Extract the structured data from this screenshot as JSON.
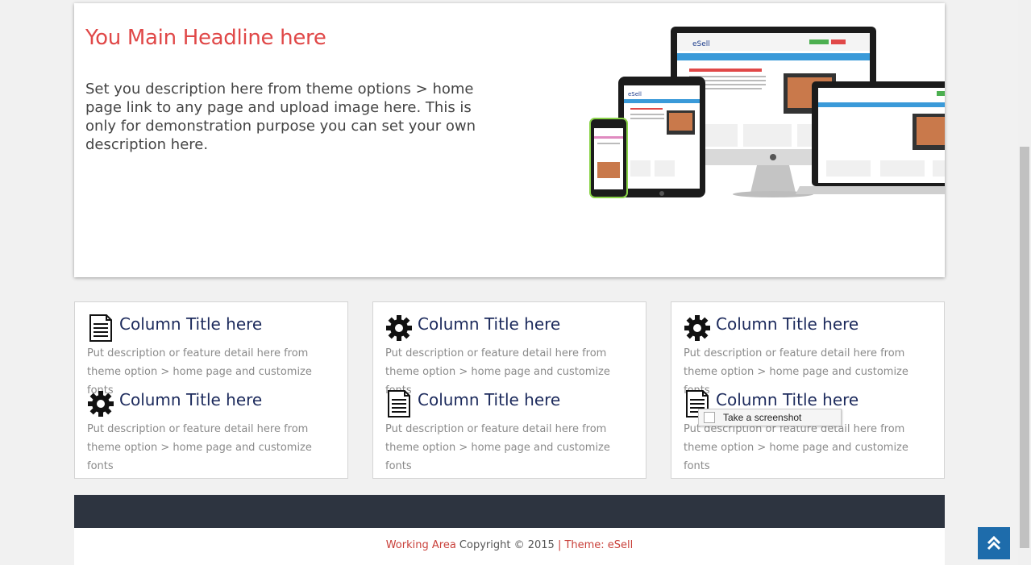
{
  "hero": {
    "headline": "You Main Headline here",
    "description": "Set you description here from theme options > home page link to any page and upload image here. This is only for demonstration purpose you can set your own description here."
  },
  "features": [
    [
      {
        "icon": "document-icon",
        "title": "Column Title here",
        "desc": "Put description or feature detail here from theme option > home page and customize fonts"
      },
      {
        "icon": "gear-icon",
        "title": "Column Title here",
        "desc": "Put description or feature detail here from theme option > home page and customize fonts"
      }
    ],
    [
      {
        "icon": "gear-icon",
        "title": "Column Title here",
        "desc": "Put description or feature detail here from theme option > home page and customize fonts"
      },
      {
        "icon": "document-icon",
        "title": "Column Title here",
        "desc": "Put description or feature detail here from theme option > home page and customize fonts"
      }
    ],
    [
      {
        "icon": "gear-icon",
        "title": "Column Title here",
        "desc": "Put description or feature detail here from theme option > home page and customize fonts"
      },
      {
        "icon": "document-icon",
        "title": "Column Title here",
        "desc": "Put description or feature detail here from theme option > home page and customize fonts"
      }
    ]
  ],
  "footer": {
    "site_link": "Working Area",
    "copyright": " Copyright © 2015 ",
    "theme_link": "| Theme: eSell"
  },
  "context_menu": {
    "item": "Take a screenshot"
  },
  "colors": {
    "headline": "#e04848",
    "title": "#1c2a5c",
    "footer_bar": "#2d3440",
    "scroll_top": "#1e6cab"
  }
}
